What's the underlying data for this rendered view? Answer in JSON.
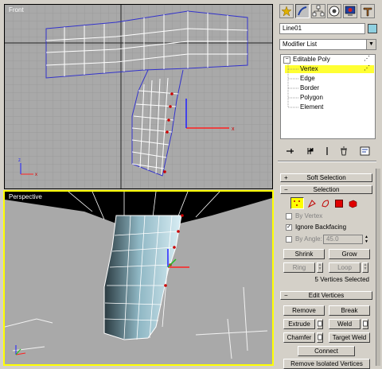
{
  "viewports": {
    "front_label": "Front",
    "perspective_label": "Perspective"
  },
  "panel": {
    "object_name": "Line01",
    "modifier_list": "Modifier List",
    "stack": {
      "root": "Editable Poly",
      "items": [
        "Vertex",
        "Edge",
        "Border",
        "Polygon",
        "Element"
      ],
      "selected": "Vertex"
    },
    "soft_selection": "Soft Selection",
    "selection": {
      "title": "Selection",
      "by_vertex": "By Vertex",
      "ignore_backfacing": "Ignore Backfacing",
      "by_angle": "By Angle:",
      "angle_value": "45.0",
      "shrink": "Shrink",
      "grow": "Grow",
      "ring": "Ring",
      "loop": "Loop",
      "status": "5 Vertices Selected"
    },
    "edit_vertices": {
      "title": "Edit Vertices",
      "remove": "Remove",
      "break": "Break",
      "extrude": "Extrude",
      "weld": "Weld",
      "chamfer": "Chamfer",
      "target_weld": "Target Weld",
      "connect": "Connect",
      "remove_isolated": "Remove Isolated Vertices"
    }
  },
  "colors": {
    "viewport_bg": "#a9a9a9",
    "active_border": "#ffff00",
    "selected_item": "#ffff33",
    "mesh_fill": "#8fb7c4"
  }
}
